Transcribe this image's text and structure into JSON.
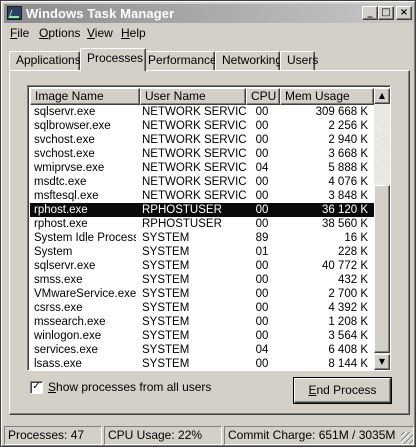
{
  "window": {
    "title": "Windows Task Manager"
  },
  "title_buttons": {
    "minimize": "_",
    "maximize": "□",
    "close": "×"
  },
  "menu": [
    {
      "label_u": "F",
      "label_rest": "ile"
    },
    {
      "label_u": "O",
      "label_rest": "ptions"
    },
    {
      "label_u": "V",
      "label_rest": "iew"
    },
    {
      "label_u": "H",
      "label_rest": "elp"
    }
  ],
  "tabs": [
    "Applications",
    "Processes",
    "Performance",
    "Networking",
    "Users"
  ],
  "active_tab": "Processes",
  "columns": {
    "name": "Image Name",
    "user": "User Name",
    "cpu": "CPU",
    "mem": "Mem Usage"
  },
  "processes": [
    {
      "name": "sqlservr.exe",
      "user": "NETWORK SERVICE",
      "cpu": "00",
      "mem": "309 668 K"
    },
    {
      "name": "sqlbrowser.exe",
      "user": "NETWORK SERVICE",
      "cpu": "00",
      "mem": "2 256 K"
    },
    {
      "name": "svchost.exe",
      "user": "NETWORK SERVICE",
      "cpu": "00",
      "mem": "2 940 K"
    },
    {
      "name": "svchost.exe",
      "user": "NETWORK SERVICE",
      "cpu": "00",
      "mem": "3 668 K"
    },
    {
      "name": "wmiprvse.exe",
      "user": "NETWORK SERVICE",
      "cpu": "04",
      "mem": "5 888 K"
    },
    {
      "name": "msdtc.exe",
      "user": "NETWORK SERVICE",
      "cpu": "00",
      "mem": "4 076 K"
    },
    {
      "name": "msftesql.exe",
      "user": "NETWORK SERVICE",
      "cpu": "00",
      "mem": "3 848 K"
    },
    {
      "name": "rphost.exe",
      "user": "RPHOSTUSER",
      "cpu": "00",
      "mem": "36 120 K",
      "selected": true
    },
    {
      "name": "rphost.exe",
      "user": "RPHOSTUSER",
      "cpu": "00",
      "mem": "38 560 K"
    },
    {
      "name": "System Idle Process",
      "user": "SYSTEM",
      "cpu": "89",
      "mem": "16 K"
    },
    {
      "name": "System",
      "user": "SYSTEM",
      "cpu": "01",
      "mem": "228 K"
    },
    {
      "name": "sqlservr.exe",
      "user": "SYSTEM",
      "cpu": "00",
      "mem": "40 772 K"
    },
    {
      "name": "smss.exe",
      "user": "SYSTEM",
      "cpu": "00",
      "mem": "432 K"
    },
    {
      "name": "VMwareService.exe",
      "user": "SYSTEM",
      "cpu": "00",
      "mem": "2 700 K"
    },
    {
      "name": "csrss.exe",
      "user": "SYSTEM",
      "cpu": "00",
      "mem": "4 392 K"
    },
    {
      "name": "mssearch.exe",
      "user": "SYSTEM",
      "cpu": "00",
      "mem": "1 208 K"
    },
    {
      "name": "winlogon.exe",
      "user": "SYSTEM",
      "cpu": "00",
      "mem": "3 564 K"
    },
    {
      "name": "services.exe",
      "user": "SYSTEM",
      "cpu": "04",
      "mem": "6 408 K"
    },
    {
      "name": "lsass.exe",
      "user": "SYSTEM",
      "cpu": "00",
      "mem": "8 144 K"
    }
  ],
  "show_all_users": {
    "checked": true,
    "mark": "✓",
    "label_u": "S",
    "label_rest": "how processes from all users"
  },
  "end_process": {
    "label_u": "E",
    "label_rest": "nd Process"
  },
  "status": {
    "processes": "Processes: 47",
    "cpu": "CPU Usage: 22%",
    "commit": "Commit Charge: 651M / 3035M"
  }
}
